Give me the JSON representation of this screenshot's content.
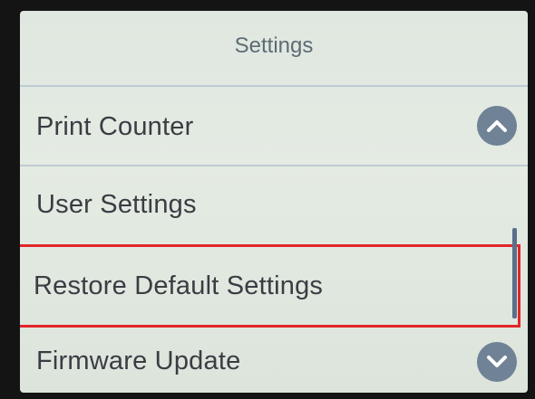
{
  "header": {
    "title": "Settings"
  },
  "menu": {
    "items": [
      {
        "label": "Print Counter"
      },
      {
        "label": "User Settings"
      },
      {
        "label": "Restore Default Settings"
      },
      {
        "label": "Firmware Update"
      }
    ],
    "selected_index": 2
  },
  "scroll": {
    "up_icon": "chevron-up-icon",
    "down_icon": "chevron-down-icon"
  },
  "colors": {
    "selection_border": "#e2262a",
    "scroll_button": "#6f8296",
    "screen_background": "#e1e8e0"
  }
}
